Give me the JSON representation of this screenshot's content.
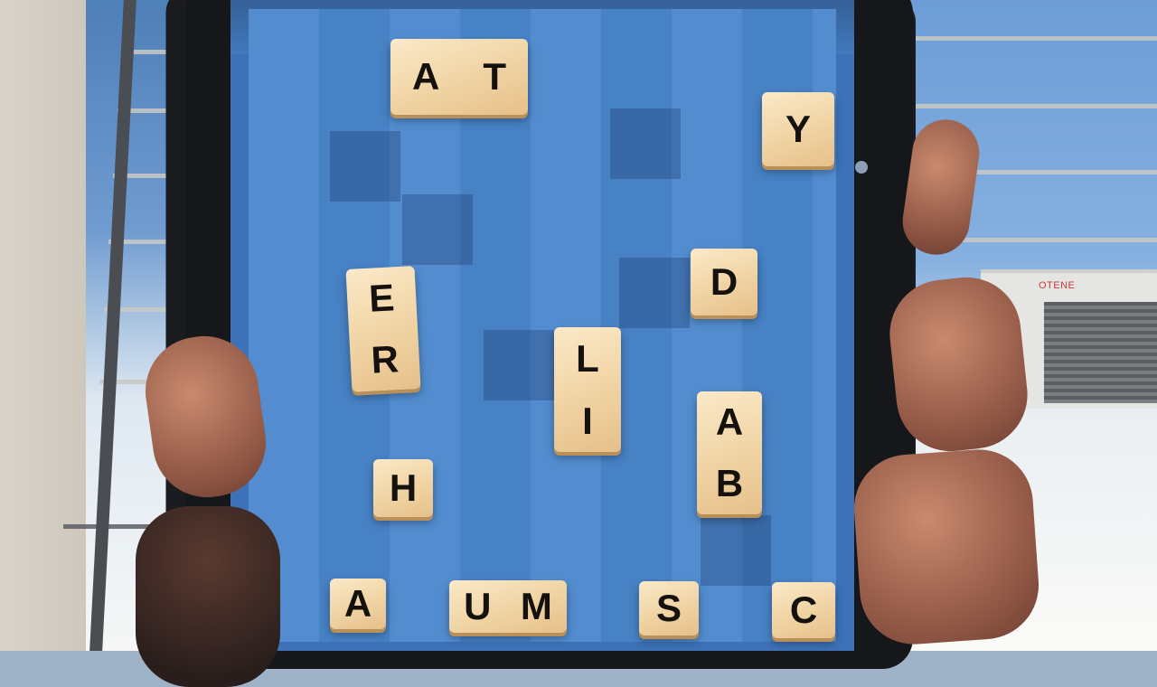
{
  "game": {
    "screen_name": "word-tile-board",
    "tiles": [
      {
        "id": "at",
        "letters": [
          "A",
          "T"
        ]
      },
      {
        "id": "y",
        "letters": [
          "Y"
        ]
      },
      {
        "id": "er",
        "letters": [
          "E",
          "R"
        ]
      },
      {
        "id": "d",
        "letters": [
          "D"
        ]
      },
      {
        "id": "li",
        "letters": [
          "L",
          "I"
        ]
      },
      {
        "id": "ab",
        "letters": [
          "A",
          "B"
        ]
      },
      {
        "id": "h",
        "letters": [
          "H"
        ]
      },
      {
        "id": "a",
        "letters": [
          "A"
        ]
      },
      {
        "id": "um",
        "letters": [
          "U",
          "M"
        ]
      },
      {
        "id": "s",
        "letters": [
          "S"
        ]
      },
      {
        "id": "c",
        "letters": [
          "C"
        ]
      }
    ]
  },
  "background": {
    "building_sign": "OTENE"
  },
  "colors": {
    "board": "#4a87cd",
    "tile": "#f0d3a3",
    "letter": "#15110e"
  }
}
